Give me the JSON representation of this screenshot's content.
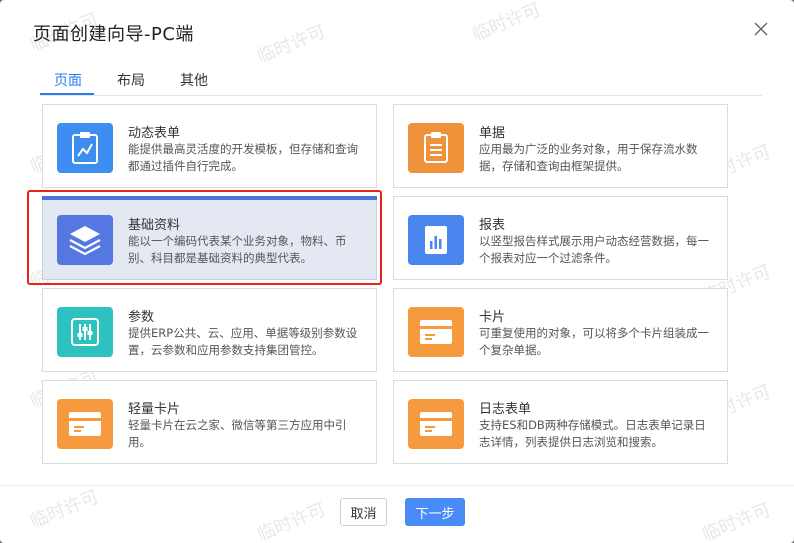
{
  "dialog": {
    "title": "页面创建向导-PC端"
  },
  "tabs": [
    {
      "label": "页面",
      "active": true
    },
    {
      "label": "布局",
      "active": false
    },
    {
      "label": "其他",
      "active": false
    }
  ],
  "cards": [
    {
      "title": "动态表单",
      "desc": "能提供最高灵活度的开发模板，但存储和查询都通过插件自行完成。",
      "icon": "form-chart-icon",
      "color": "#3d8ef0",
      "selected": false
    },
    {
      "title": "单据",
      "desc": "应用最为广泛的业务对象，用于保存流水数据，存储和查询由框架提供。",
      "icon": "document-icon",
      "color": "#f0923a",
      "selected": false
    },
    {
      "title": "基础资料",
      "desc": "能以一个编码代表某个业务对象，物料、币别、科目都是基础资料的典型代表。",
      "icon": "layers-icon",
      "color": "#5577e0",
      "selected": true
    },
    {
      "title": "报表",
      "desc": "以竖型报告样式展示用户动态经营数据，每一个报表对应一个过滤条件。",
      "icon": "report-chart-icon",
      "color": "#4a86ee",
      "selected": false
    },
    {
      "title": "参数",
      "desc": "提供ERP公共、云、应用、单据等级别参数设置，云参数和应用参数支持集团管控。",
      "icon": "sliders-icon",
      "color": "#2dc2c0",
      "selected": false
    },
    {
      "title": "卡片",
      "desc": "可重复使用的对象，可以将多个卡片组装成一个复杂单据。",
      "icon": "card-icon",
      "color": "#f59a3e",
      "selected": false
    },
    {
      "title": "轻量卡片",
      "desc": "轻量卡片在云之家、微信等第三方应用中引用。",
      "icon": "card-icon",
      "color": "#f59a3e",
      "selected": false
    },
    {
      "title": "日志表单",
      "desc": "支持ES和DB两种存储模式。日志表单记录日志详情，列表提供日志浏览和搜索。",
      "icon": "card-icon",
      "color": "#f59a3e",
      "selected": false
    }
  ],
  "footer": {
    "cancel_label": "取消",
    "next_label": "下一步"
  },
  "watermark": "临时许可"
}
